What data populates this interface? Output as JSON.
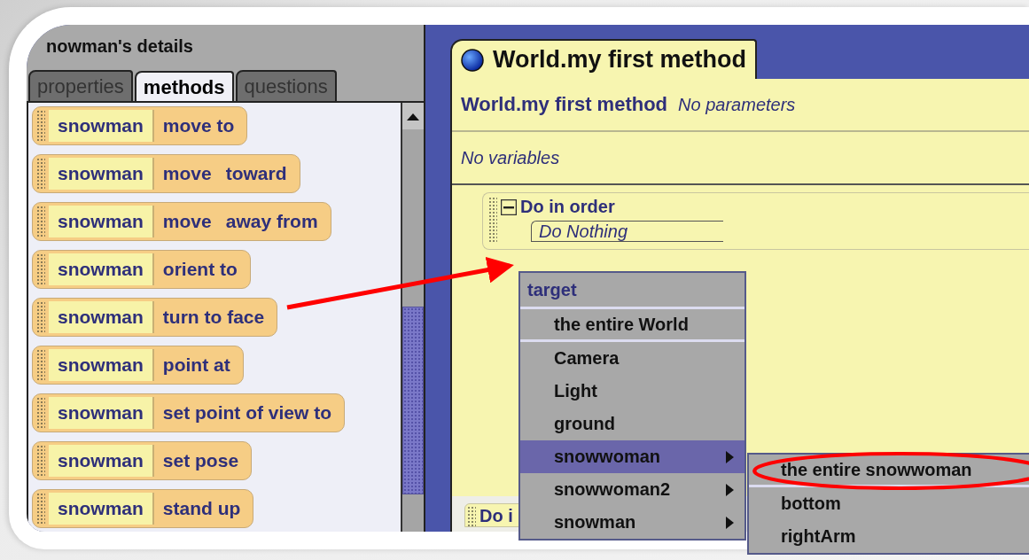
{
  "details_panel": {
    "title": "nowman's details",
    "tabs": [
      {
        "label": "properties",
        "selected": false
      },
      {
        "label": "methods",
        "selected": true
      },
      {
        "label": "questions",
        "selected": false
      }
    ],
    "methods": [
      {
        "object": "snowman",
        "parts": [
          "move to"
        ]
      },
      {
        "object": "snowman",
        "parts": [
          "move",
          "toward"
        ]
      },
      {
        "object": "snowman",
        "parts": [
          "move",
          "away from"
        ]
      },
      {
        "object": "snowman",
        "parts": [
          "orient to"
        ]
      },
      {
        "object": "snowman",
        "parts": [
          "turn to face"
        ]
      },
      {
        "object": "snowman",
        "parts": [
          "point at"
        ]
      },
      {
        "object": "snowman",
        "parts": [
          "set point of view to"
        ]
      },
      {
        "object": "snowman",
        "parts": [
          "set pose"
        ]
      },
      {
        "object": "snowman",
        "parts": [
          "stand up"
        ]
      }
    ]
  },
  "editor": {
    "tab": "World.my first method",
    "method_name": "World.my first method",
    "parameters": "No parameters",
    "variables": "No variables",
    "blocks": [
      {
        "label": "Do in order",
        "expanded": true,
        "statement": "Do Nothing"
      },
      {
        "label": "Do i"
      }
    ]
  },
  "target_menu": {
    "title": "target",
    "items": [
      {
        "label": "the entire World",
        "has_submenu": false,
        "selected": false,
        "separator_after": true
      },
      {
        "label": "Camera",
        "has_submenu": false,
        "selected": false
      },
      {
        "label": "Light",
        "has_submenu": false,
        "selected": false
      },
      {
        "label": "ground",
        "has_submenu": false,
        "selected": false
      },
      {
        "label": "snowwoman",
        "has_submenu": true,
        "selected": true
      },
      {
        "label": "snowwoman2",
        "has_submenu": true,
        "selected": false
      },
      {
        "label": "snowman",
        "has_submenu": true,
        "selected": false
      }
    ]
  },
  "submenu": {
    "items": [
      {
        "label": "the entire snowwoman",
        "circled": true,
        "separator_after": true
      },
      {
        "label": "bottom",
        "circled": false
      },
      {
        "label": "rightArm",
        "circled": false
      }
    ]
  }
}
